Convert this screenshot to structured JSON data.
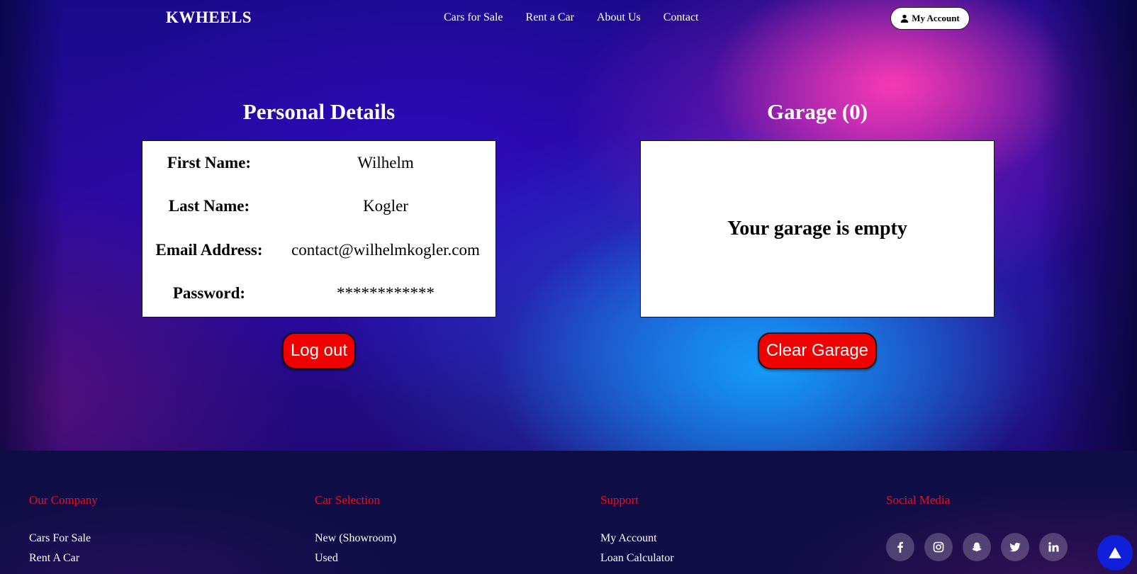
{
  "navbar": {
    "brand": "KWHEELS",
    "links": [
      "Cars for Sale",
      "Rent a Car",
      "About Us",
      "Contact"
    ],
    "account_label": "My Account"
  },
  "personal": {
    "title": "Personal Details",
    "rows": [
      {
        "label": "First Name:",
        "value": "Wilhelm"
      },
      {
        "label": "Last Name:",
        "value": "Kogler"
      },
      {
        "label": "Email Address:",
        "value": "contact@wilhelmkogler.com"
      },
      {
        "label": "Password:",
        "value": "************"
      }
    ],
    "logout_label": "Log out"
  },
  "garage": {
    "title": "Garage (0)",
    "empty_message": "Your garage is empty",
    "clear_label": "Clear Garage"
  },
  "footer": {
    "columns": [
      {
        "heading": "Our Company",
        "links": [
          "Cars For Sale",
          "Rent A Car"
        ]
      },
      {
        "heading": "Car Selection",
        "links": [
          "New (Showroom)",
          "Used"
        ]
      },
      {
        "heading": "Support",
        "links": [
          "My Account",
          "Loan Calculator"
        ]
      },
      {
        "heading": "Social Media",
        "icons": [
          "facebook-icon",
          "instagram-icon",
          "snapchat-icon",
          "twitter-icon",
          "linkedin-icon"
        ]
      }
    ]
  },
  "colors": {
    "accent_red": "#f20000",
    "footer_heading": "#e8101f",
    "scroll_button": "#1020d8"
  }
}
